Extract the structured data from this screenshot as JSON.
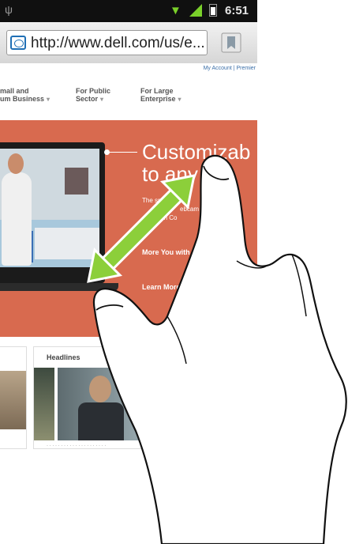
{
  "status_bar": {
    "time": "6:51",
    "icons": [
      "usb-icon",
      "wifi-icon",
      "signal-icon",
      "battery-icon"
    ],
    "accent_color": "#7ad02a"
  },
  "browser": {
    "url": "http://www.dell.com/us/e...",
    "favicon": "dell-logo-icon",
    "bookmark_icon": "bookmark-icon"
  },
  "page": {
    "top_links": "My Account  |  Premier",
    "nav": [
      {
        "label": "mall and\num Business"
      },
      {
        "label": "For Public\nSector"
      },
      {
        "label": "For Large\nEnterprise"
      }
    ],
    "hero": {
      "headline_line1": "Customizab",
      "headline_line2": "to any m",
      "text_line1": "The   spir",
      "text_line2": "ebcam",
      "text_line3": "ndGen Co",
      "link": "More You with Dell I",
      "learn_more": "Learn More ›",
      "background_color": "#d86a4f"
    },
    "headlines_label": "Headlines"
  },
  "gesture": {
    "type": "pinch-zoom",
    "arrow_color": "#8ccf3a"
  }
}
